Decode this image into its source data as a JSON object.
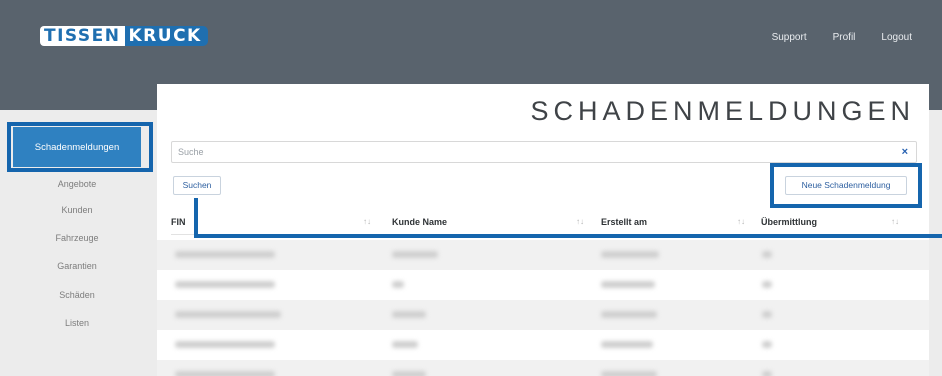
{
  "header": {
    "logo_part1": "TISSEN",
    "logo_part2": "KRUCK",
    "nav": [
      "Support",
      "Profil",
      "Logout"
    ]
  },
  "sidebar": {
    "active": "Schadenmeldungen",
    "items": [
      "Angebote",
      "Kunden",
      "Fahrzeuge",
      "Garantien",
      "Schäden",
      "Listen"
    ]
  },
  "main": {
    "title": "SCHADENMELDUNGEN",
    "search_placeholder": "Suche",
    "search_clear": "×",
    "search_button": "Suchen",
    "new_button": "Neue Schadenmeldung",
    "columns": [
      "FIN",
      "Kunde Name",
      "Erstellt am",
      "Übermittlung"
    ],
    "sort_glyph": "↑↓"
  },
  "colors": {
    "header_bg": "#59636d",
    "accent": "#2f81c1",
    "highlight": "#1565ad"
  }
}
